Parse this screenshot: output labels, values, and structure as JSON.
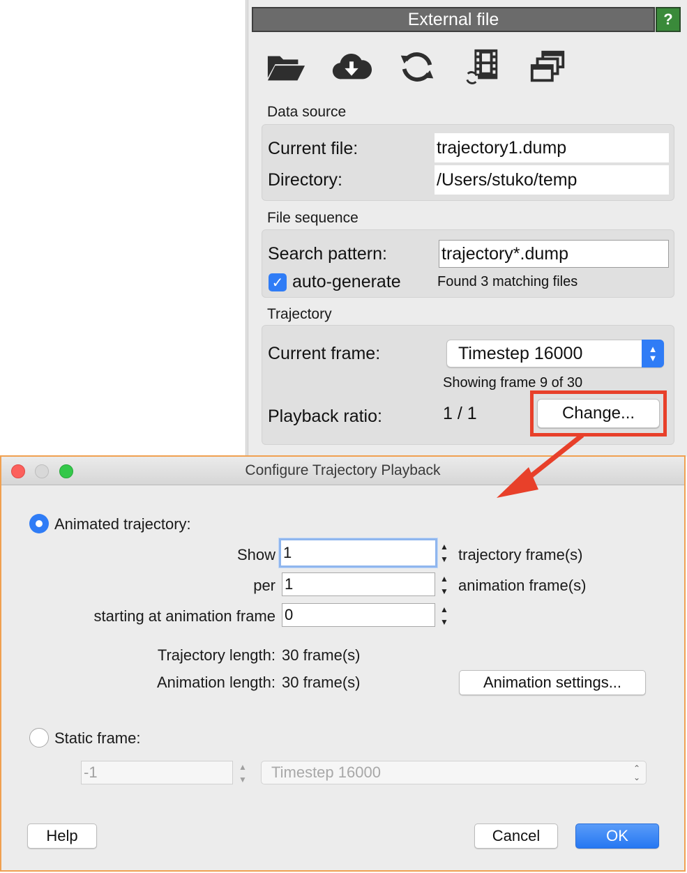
{
  "panel": {
    "title": "External file",
    "help_label": "?",
    "toolbar": {
      "icons": [
        "folder-open-icon",
        "cloud-download-icon",
        "refresh-icon",
        "film-reload-icon",
        "windows-icon"
      ]
    },
    "data_source": {
      "heading": "Data source",
      "current_file_label": "Current file:",
      "current_file_value": "trajectory1.dump",
      "directory_label": "Directory:",
      "directory_value": "/Users/stuko/temp"
    },
    "file_sequence": {
      "heading": "File sequence",
      "search_pattern_label": "Search pattern:",
      "search_pattern_value": "trajectory*.dump",
      "auto_generate_label": "auto-generate",
      "auto_generate_checked": true,
      "match_status": "Found 3 matching files"
    },
    "trajectory": {
      "heading": "Trajectory",
      "current_frame_label": "Current frame:",
      "current_frame_value": "Timestep 16000",
      "showing_frame_text": "Showing frame 9 of 30",
      "playback_ratio_label": "Playback ratio:",
      "playback_ratio_value": "1 / 1",
      "change_button_label": "Change..."
    }
  },
  "dialog": {
    "title": "Configure Trajectory Playback",
    "animated": {
      "label": "Animated trajectory:",
      "selected": true,
      "show_label": "Show",
      "show_value": "1",
      "show_suffix": "trajectory frame(s)",
      "per_label": "per",
      "per_value": "1",
      "per_suffix": "animation frame(s)",
      "start_label": "starting at animation frame",
      "start_value": "0",
      "trajectory_length_label": "Trajectory length:",
      "trajectory_length_value": "30 frame(s)",
      "animation_length_label": "Animation length:",
      "animation_length_value": "30 frame(s)",
      "animation_settings_button": "Animation settings..."
    },
    "static": {
      "label": "Static frame:",
      "selected": false,
      "frame_value": "-1",
      "timestep_value": "Timestep 16000"
    },
    "buttons": {
      "help": "Help",
      "cancel": "Cancel",
      "ok": "OK"
    }
  },
  "colors": {
    "accent_blue": "#2f7cf6",
    "highlight_red": "#e8402a",
    "dialog_border": "#f0a050",
    "panel_title_bg": "#6b6b6b",
    "help_green": "#3a8a3a"
  }
}
